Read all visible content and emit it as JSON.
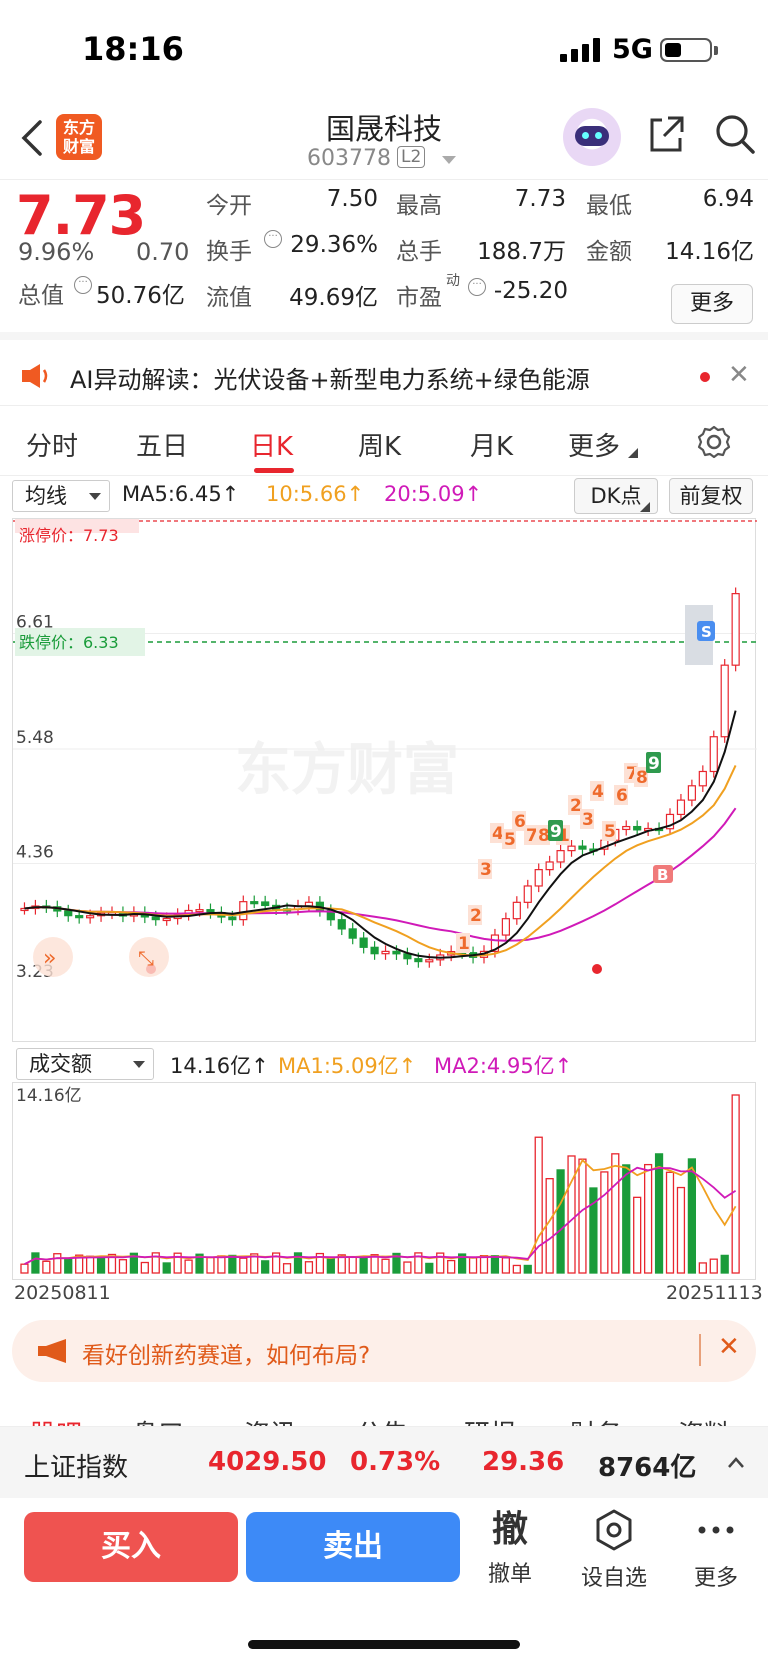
{
  "status": {
    "time": "18:16",
    "network": "5G"
  },
  "header": {
    "name": "国晟科技",
    "code": "603778",
    "level": "L2",
    "logo_text": "东方财富"
  },
  "quote": {
    "price": "7.73",
    "change_pct": "9.96%",
    "change": "0.70",
    "open_label": "今开",
    "open": "7.50",
    "high_label": "最高",
    "high": "7.73",
    "low_label": "最低",
    "low": "6.94",
    "turnover_label": "换手",
    "turnover": "29.36%",
    "volume_label": "总手",
    "volume": "188.7万",
    "amount_label": "金额",
    "amount": "14.16亿",
    "mktcap_label": "总值",
    "mktcap": "50.76亿",
    "float_label": "流值",
    "float": "49.69亿",
    "pe_label": "市盈",
    "pe_sup": "动",
    "pe": "-25.20",
    "more": "更多"
  },
  "ai_bar": {
    "text": "AI异动解读：光伏设备+新型电力系统+绿色能源"
  },
  "tabs": [
    "分时",
    "五日",
    "日K",
    "周K",
    "月K",
    "更多"
  ],
  "active_tab": 2,
  "ma": {
    "select": "均线",
    "ma5": "MA5:6.45↑",
    "ma10": "10:5.66↑",
    "ma20": "20:5.09↑",
    "dk": "DK点",
    "adjust": "前复权"
  },
  "kchart": {
    "limit_up_label": "涨停价：7.73",
    "limit_up_partial": "7.73",
    "limit_down_label": "跌停价：6.33",
    "y_labels": [
      "6.61",
      "5.48",
      "4.36",
      "3.23"
    ],
    "watermark": "东方财富",
    "signals_red": [
      "1",
      "2",
      "3",
      "4",
      "5",
      "6",
      "7",
      "8",
      "1",
      "2",
      "3",
      "4",
      "5",
      "6",
      "7",
      "8"
    ],
    "signals_green": [
      "9",
      "9"
    ],
    "buy_mark": "B",
    "sell_mark": "S"
  },
  "volume": {
    "select": "成交额",
    "value": "14.16亿↑",
    "ma1": "MA1:5.09亿↑",
    "ma2": "MA2:4.95亿↑",
    "top_label": "14.16亿",
    "date_start": "20250811",
    "date_end": "20251113"
  },
  "banner": {
    "text": "看好创新药赛道，如何布局?"
  },
  "partial_tabs": [
    "股吧",
    "盘口",
    "资讯",
    "公告",
    "研报",
    "财务",
    "资料"
  ],
  "index": {
    "name": "上证指数",
    "value": "4029.50",
    "pct": "0.73%",
    "change": "29.36",
    "amount": "8764亿"
  },
  "bottom": {
    "buy": "买入",
    "sell": "卖出",
    "cancel_icon": "撤",
    "cancel": "撤单",
    "watch": "设自选",
    "more": "更多"
  },
  "colors": {
    "up": "#e8262e",
    "down": "#1a9c3a",
    "ma10": "#f0a020",
    "ma20": "#d01ab8",
    "brand": "#f05a22"
  }
}
